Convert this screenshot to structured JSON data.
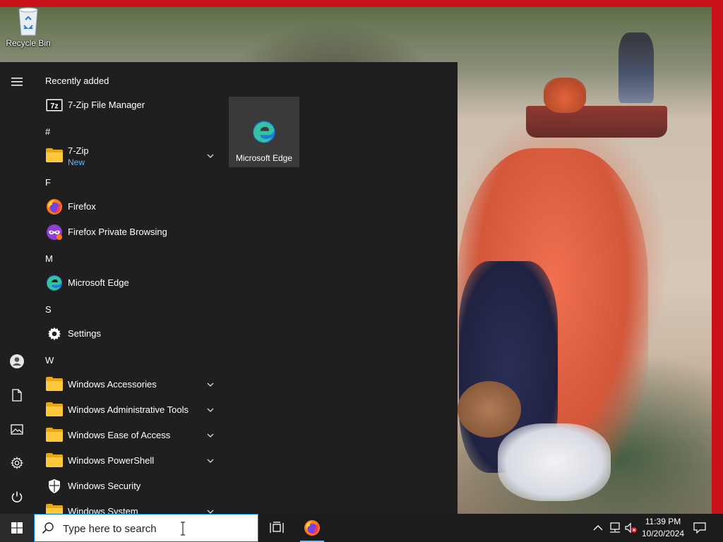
{
  "desktop": {
    "recycle_bin_label": "Recycle Bin"
  },
  "start_menu": {
    "rail": [
      {
        "name": "expand-menu",
        "icon": "hamburger-icon"
      },
      {
        "name": "user-account",
        "icon": "user-icon"
      },
      {
        "name": "documents",
        "icon": "document-icon"
      },
      {
        "name": "pictures",
        "icon": "pictures-icon"
      },
      {
        "name": "settings",
        "icon": "gear-icon"
      },
      {
        "name": "power",
        "icon": "power-icon"
      }
    ],
    "recently_added_header": "Recently added",
    "sections": {
      "hash": "#",
      "f": "F",
      "m": "M",
      "s": "S",
      "w": "W"
    },
    "apps": {
      "seven_zip_fm": "7-Zip File Manager",
      "seven_zip": "7-Zip",
      "seven_zip_badge": "New",
      "firefox": "Firefox",
      "firefox_private": "Firefox Private Browsing",
      "edge": "Microsoft Edge",
      "settings": "Settings",
      "win_accessories": "Windows Accessories",
      "win_admin_tools": "Windows Administrative Tools",
      "win_ease": "Windows Ease of Access",
      "win_powershell": "Windows PowerShell",
      "win_security": "Windows Security",
      "win_system": "Windows System"
    },
    "tiles": [
      {
        "label": "Microsoft Edge",
        "icon": "edge-icon"
      }
    ]
  },
  "taskbar": {
    "search_placeholder": "Type here to search",
    "pinned": [
      {
        "name": "task-view",
        "icon": "task-view-icon"
      },
      {
        "name": "firefox",
        "icon": "firefox-icon",
        "active": true
      }
    ],
    "tray": {
      "time": "11:39 PM",
      "date": "10/20/2024"
    }
  },
  "colors": {
    "accent": "#0078d7",
    "start_bg": "#1f1f1f",
    "taskbar_bg": "#1c1c1c",
    "new_badge": "#6cb4f0",
    "folder": "#ffc83d",
    "frame_red": "#c9111a"
  }
}
